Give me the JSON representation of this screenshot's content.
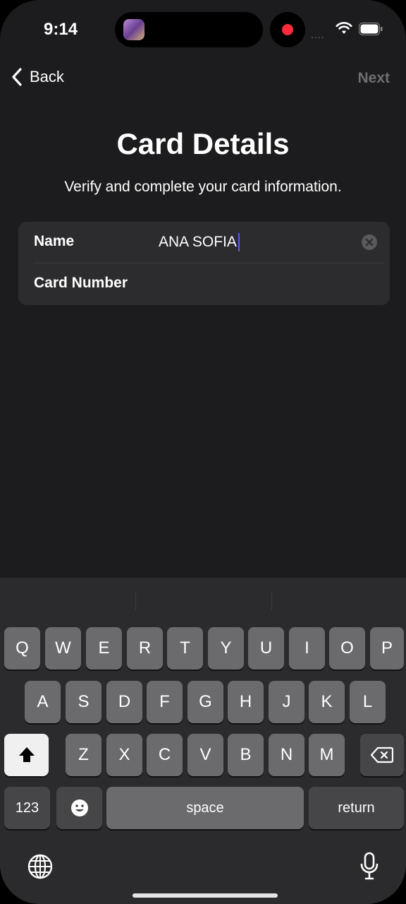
{
  "status_bar": {
    "time": "9:14",
    "signal_dots": "....",
    "recording_color": "#ff2b3b"
  },
  "nav": {
    "back_label": "Back",
    "next_label": "Next"
  },
  "header": {
    "title": "Card Details",
    "subtitle": "Verify and complete your card information."
  },
  "form": {
    "name_label": "Name",
    "name_value": "ANA SOFIA",
    "card_number_label": "Card Number",
    "card_number_value": ""
  },
  "keyboard": {
    "row1": [
      "Q",
      "W",
      "E",
      "R",
      "T",
      "Y",
      "U",
      "I",
      "O",
      "P"
    ],
    "row2": [
      "A",
      "S",
      "D",
      "F",
      "G",
      "H",
      "J",
      "K",
      "L"
    ],
    "row3": [
      "Z",
      "X",
      "C",
      "V",
      "B",
      "N",
      "M"
    ],
    "numbers_label": "123",
    "space_label": "space",
    "return_label": "return"
  },
  "colors": {
    "background": "#1c1c1e",
    "card": "#2c2c2e",
    "caret": "#5e5ce6",
    "next_disabled": "#6e6e73"
  }
}
